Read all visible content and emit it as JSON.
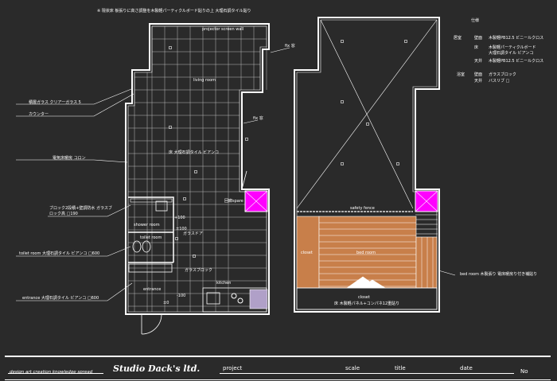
{
  "plan_left": {
    "top_note": "※ 現状床 板張りに高さ調整を木製軽パーティクルボード貼りの上 大理石調タイル貼り",
    "rooms": {
      "projector_wall": "projector screen wall",
      "living": "living room",
      "spare": "回廊spare",
      "shower": "shower room",
      "toilet": "toilet room",
      "kitchen": "kitchen",
      "entrance": "entrance"
    },
    "inner_labels": {
      "floor": "床 大理石調タイル ビアンコ",
      "glass": "ガラスブロック",
      "shower_door": "ガラスドア",
      "h_mark": "±0",
      "h_value": "-100",
      "h_value2": "+100",
      "h_value3": "±100"
    },
    "left_notes": [
      "積層ガラス クリアーガラス 5",
      "カウンター",
      "電気床暖房 コロン",
      "ブロック2段積+壁調防水 ガラスブロック高 □190",
      "toilet room 大理石調タイル ビアンコ □600",
      "entrance 大理石調タイル ビアンコ □600"
    ],
    "right_notes": [
      "fix 窓",
      "fix 窓"
    ]
  },
  "plan_right": {
    "rooms": {
      "safety_fence": "safety fence",
      "closet_left": "closet",
      "bed": "bed room",
      "closet_bottom": "closet"
    },
    "floor_note": "床 木製軽パネル+コンパネ12重貼り",
    "bed_note": "bed room 木製張り 電床暖房り付き補貼り"
  },
  "finish_schedule": {
    "heading": "仕様",
    "rows": [
      {
        "room": "居室",
        "part": "壁面",
        "spec": "木製軽PB12.5 ビニールクロス"
      },
      {
        "room": "",
        "part": "床",
        "spec": "木製軽パーティクルボード"
      },
      {
        "room": "",
        "part": "",
        "spec": "大理石調タイル ビアンコ"
      },
      {
        "room": "",
        "part": "天井",
        "spec": "木製軽PB12.5 ビニールクロス"
      },
      {
        "room": "浴室",
        "part": "壁面",
        "spec": "ガラスブロック"
      },
      {
        "room": "",
        "part": "天井",
        "spec": "バスリブ □"
      }
    ]
  },
  "title_block": {
    "tagline": "design art creation knowledge spread",
    "brand": "Studio Dack's ltd.",
    "project": "project",
    "scale": "scale",
    "title": "title",
    "date": "date",
    "no": "No"
  },
  "colors": {
    "background": "#2a2a2a",
    "lines": "#ffffff",
    "accent_magenta": "#ff00ff",
    "wood_floor": "#c87f4a"
  }
}
